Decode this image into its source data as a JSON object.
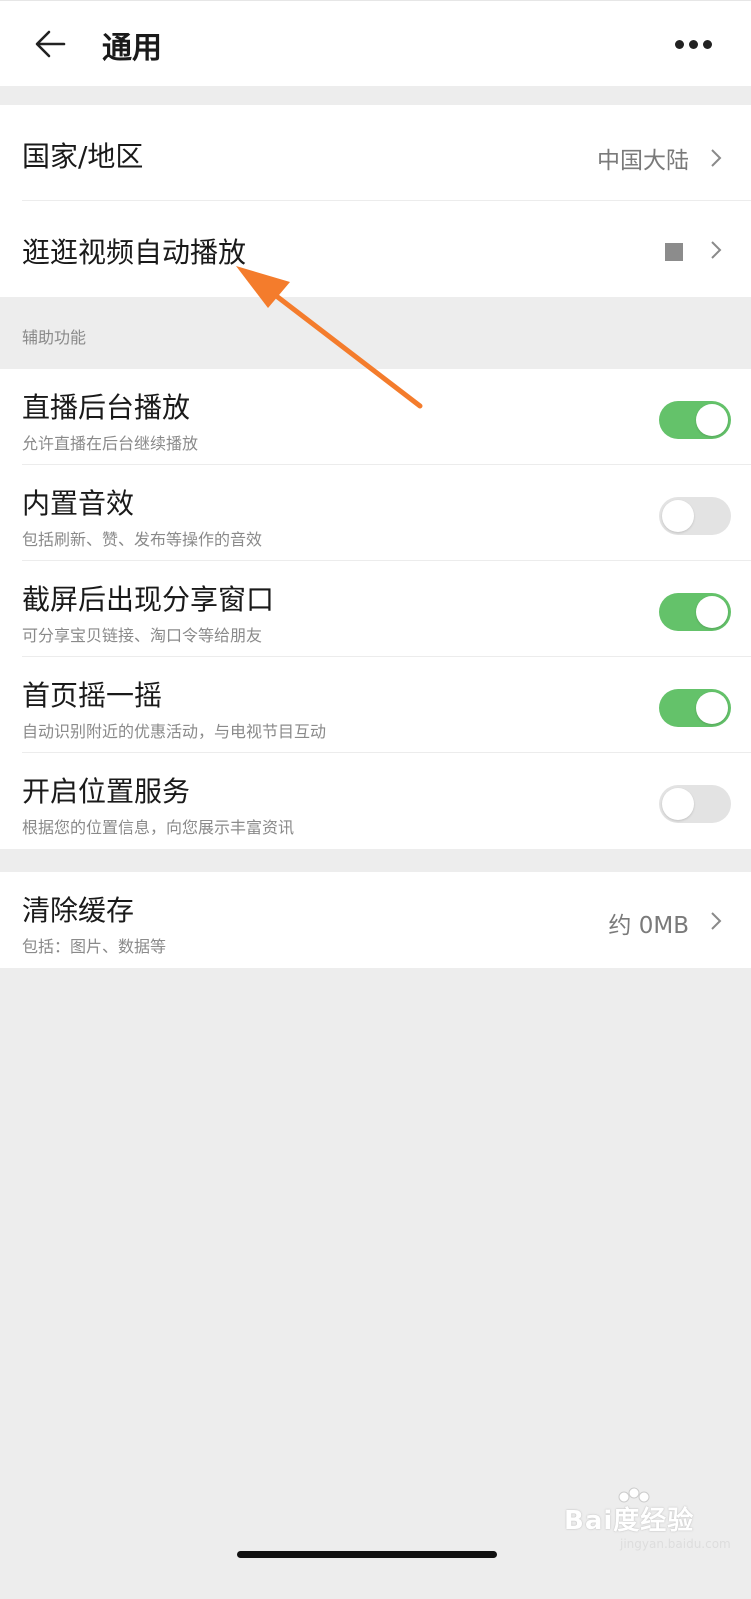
{
  "header": {
    "title": "通用"
  },
  "groups": {
    "region": {
      "label": "国家/地区",
      "value": "中国大陆"
    },
    "autoplay": {
      "label": "逛逛视频自动播放"
    }
  },
  "accessibility": {
    "section_title": "辅助功能",
    "items": [
      {
        "label": "直播后台播放",
        "sub": "允许直播在后台继续播放",
        "state": "on"
      },
      {
        "label": "内置音效",
        "sub": "包括刷新、赞、发布等操作的音效",
        "state": "off"
      },
      {
        "label": "截屏后出现分享窗口",
        "sub": "可分享宝贝链接、淘口令等给朋友",
        "state": "on"
      },
      {
        "label": "首页摇一摇",
        "sub": "自动识别附近的优惠活动，与电视节目互动",
        "state": "on"
      },
      {
        "label": "开启位置服务",
        "sub": "根据您的位置信息，向您展示丰富资讯",
        "state": "off"
      }
    ]
  },
  "cache": {
    "label": "清除缓存",
    "sub": "包括：图片、数据等",
    "value": "约 0MB"
  },
  "watermark": {
    "brand": "Bai度经验",
    "domain": "jingyan.baidu.com"
  },
  "colors": {
    "toggle_on": "#64c26a",
    "toggle_off": "#e3e3e3",
    "annotation_arrow": "#f47c2c",
    "background": "#ededed"
  }
}
